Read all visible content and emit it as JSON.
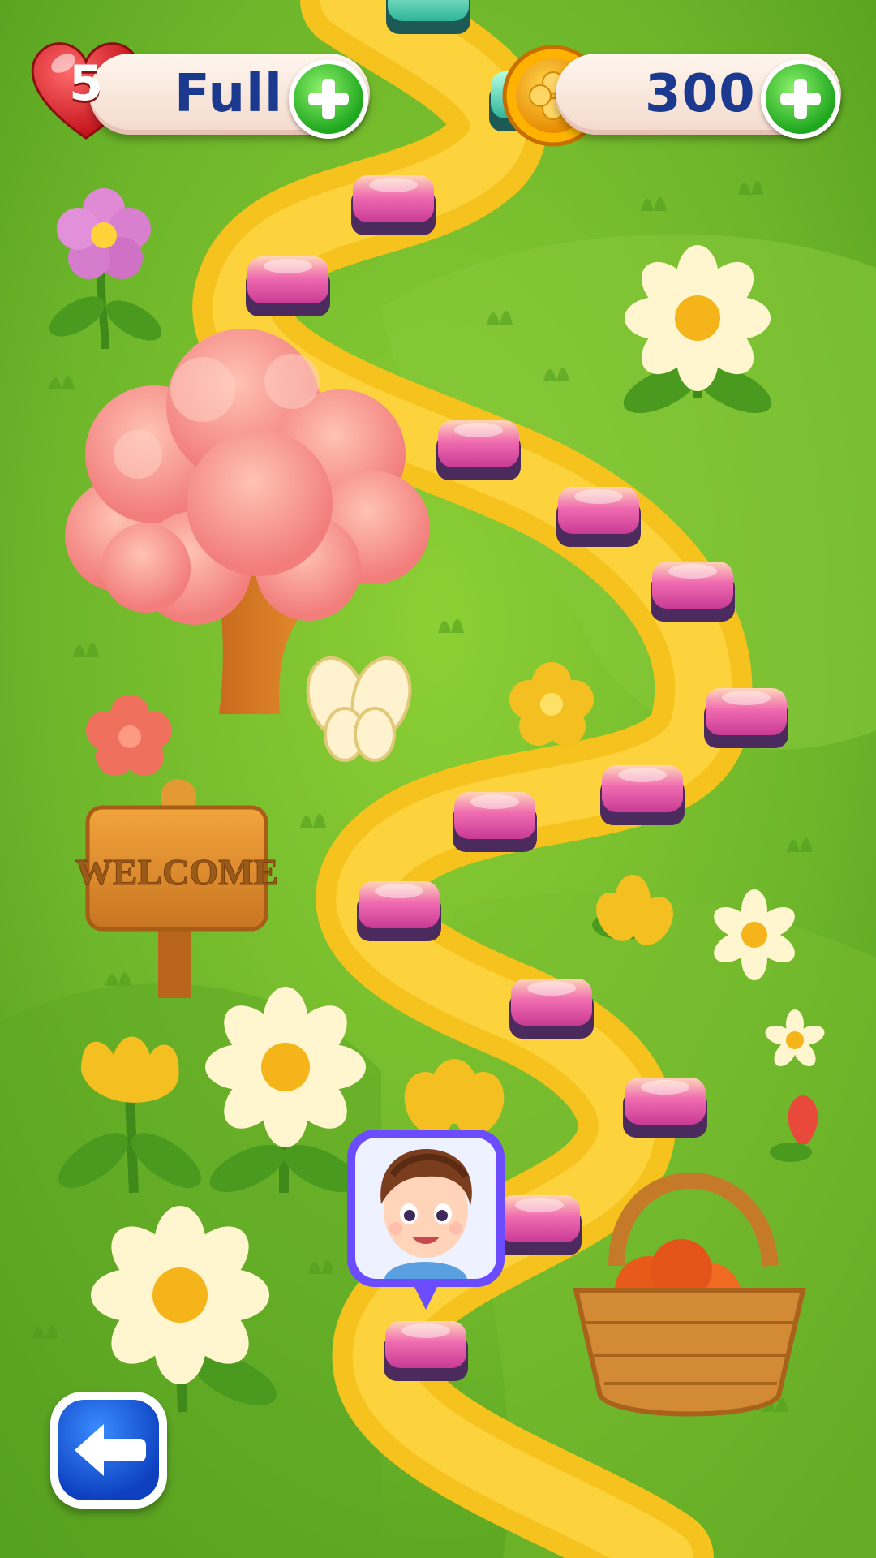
{
  "hud": {
    "lives": {
      "count": "5",
      "status": "Full"
    },
    "coins": {
      "amount": "300"
    }
  },
  "icons": {
    "lives": "heart-icon",
    "coins": "clover-coin-icon",
    "add": "plus-icon",
    "back": "arrow-left-icon"
  },
  "scenery": {
    "sign_text": "WELCOME"
  },
  "map": {
    "current_level_index": 1,
    "level_node_count": 17
  },
  "colors": {
    "grass": "#6fb52a",
    "path": "#f5c21e",
    "level_node": "#e24fa6",
    "level_node_base": "#4b2a5e",
    "hud_text": "#1b3a8f",
    "plus_button": "#1fa81f",
    "back_button": "#0d3fbf"
  }
}
